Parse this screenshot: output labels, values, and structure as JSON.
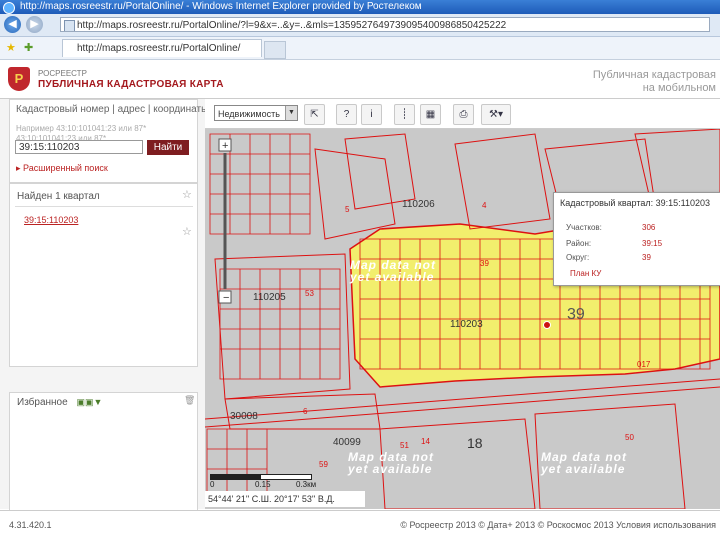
{
  "browser": {
    "title": "http://maps.rosreestr.ru/PortalOnline/ - Windows Internet Explorer provided by Ростелеком",
    "address": "http://maps.rosreestr.ru/PortalOnline/?l=9&x=..&y=..&mls=1359527649739095400986850425222",
    "tab_title": "http://maps.rosreestr.ru/PortalOnline/"
  },
  "header": {
    "org": "РОСРЕЕСТР",
    "app_title": "ПУБЛИЧНАЯ КАДАСТРОВАЯ КАРТА",
    "promo_line1": "Публичная кадастровая",
    "promo_line2": "на мобильном"
  },
  "search": {
    "tabs": "Кадастровый номер | адрес | координаты",
    "hint1": "Например 43:10:101041:23 или 87*",
    "hint2": "43:10:101041:23 или 87*",
    "value": "39:15:110203",
    "button": "Найти",
    "advanced": "Расширенный поиск"
  },
  "results": {
    "header": "Найден 1 квартал",
    "item": "39:15:110203"
  },
  "favorites": {
    "header": "Избранное"
  },
  "toolbar": {
    "layer": "Недвижимость"
  },
  "map": {
    "labels": [
      "110206",
      "110205",
      "110203",
      "30008",
      "40099",
      "18",
      "39",
      "017",
      "5",
      "4",
      "6",
      "51",
      "14",
      "50",
      "53",
      "39",
      "59"
    ],
    "no_data": "Map data not yet available",
    "scale_ticks": [
      "0",
      "0.15",
      "0.3км"
    ],
    "coords": "54°44' 21'' С.Ш.  20°17' 53'' В.Д."
  },
  "popup": {
    "title": "Кадастровый квартал: 39:15:110203",
    "rows": [
      {
        "label": "Участков:",
        "value": "306"
      },
      {
        "label": "Район:",
        "value": "39:15"
      },
      {
        "label": "Округ:",
        "value": "39"
      }
    ],
    "plan": "План КУ"
  },
  "footer": {
    "version": "4.31.420.1",
    "copyright": "© Росреестр 2013  © Дата+ 2013  © Роскосмос 2013  Условия использования"
  }
}
